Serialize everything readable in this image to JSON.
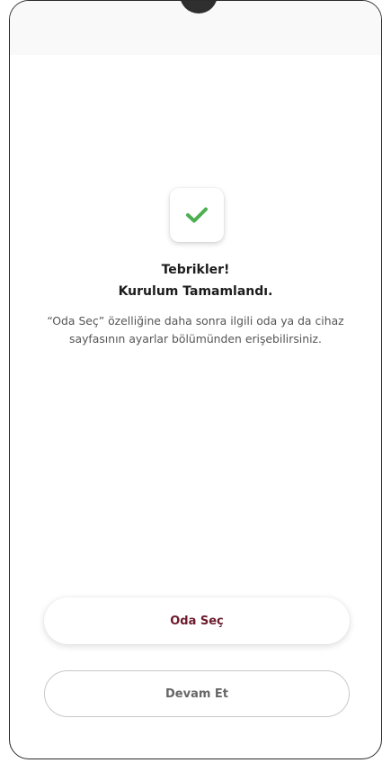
{
  "success": {
    "icon": "check-icon",
    "icon_color": "#4caf50",
    "title_line1": "Tebrikler!",
    "title_line2": "Kurulum Tamamlandı.",
    "description": "“Oda Seç” özelliğine daha sonra ilgili oda ya da cihaz sayfasının ayarlar bölümünden erişebilirsiniz."
  },
  "actions": {
    "primary_label": "Oda Seç",
    "secondary_label": "Devam Et",
    "primary_color": "#6b1a2c"
  }
}
